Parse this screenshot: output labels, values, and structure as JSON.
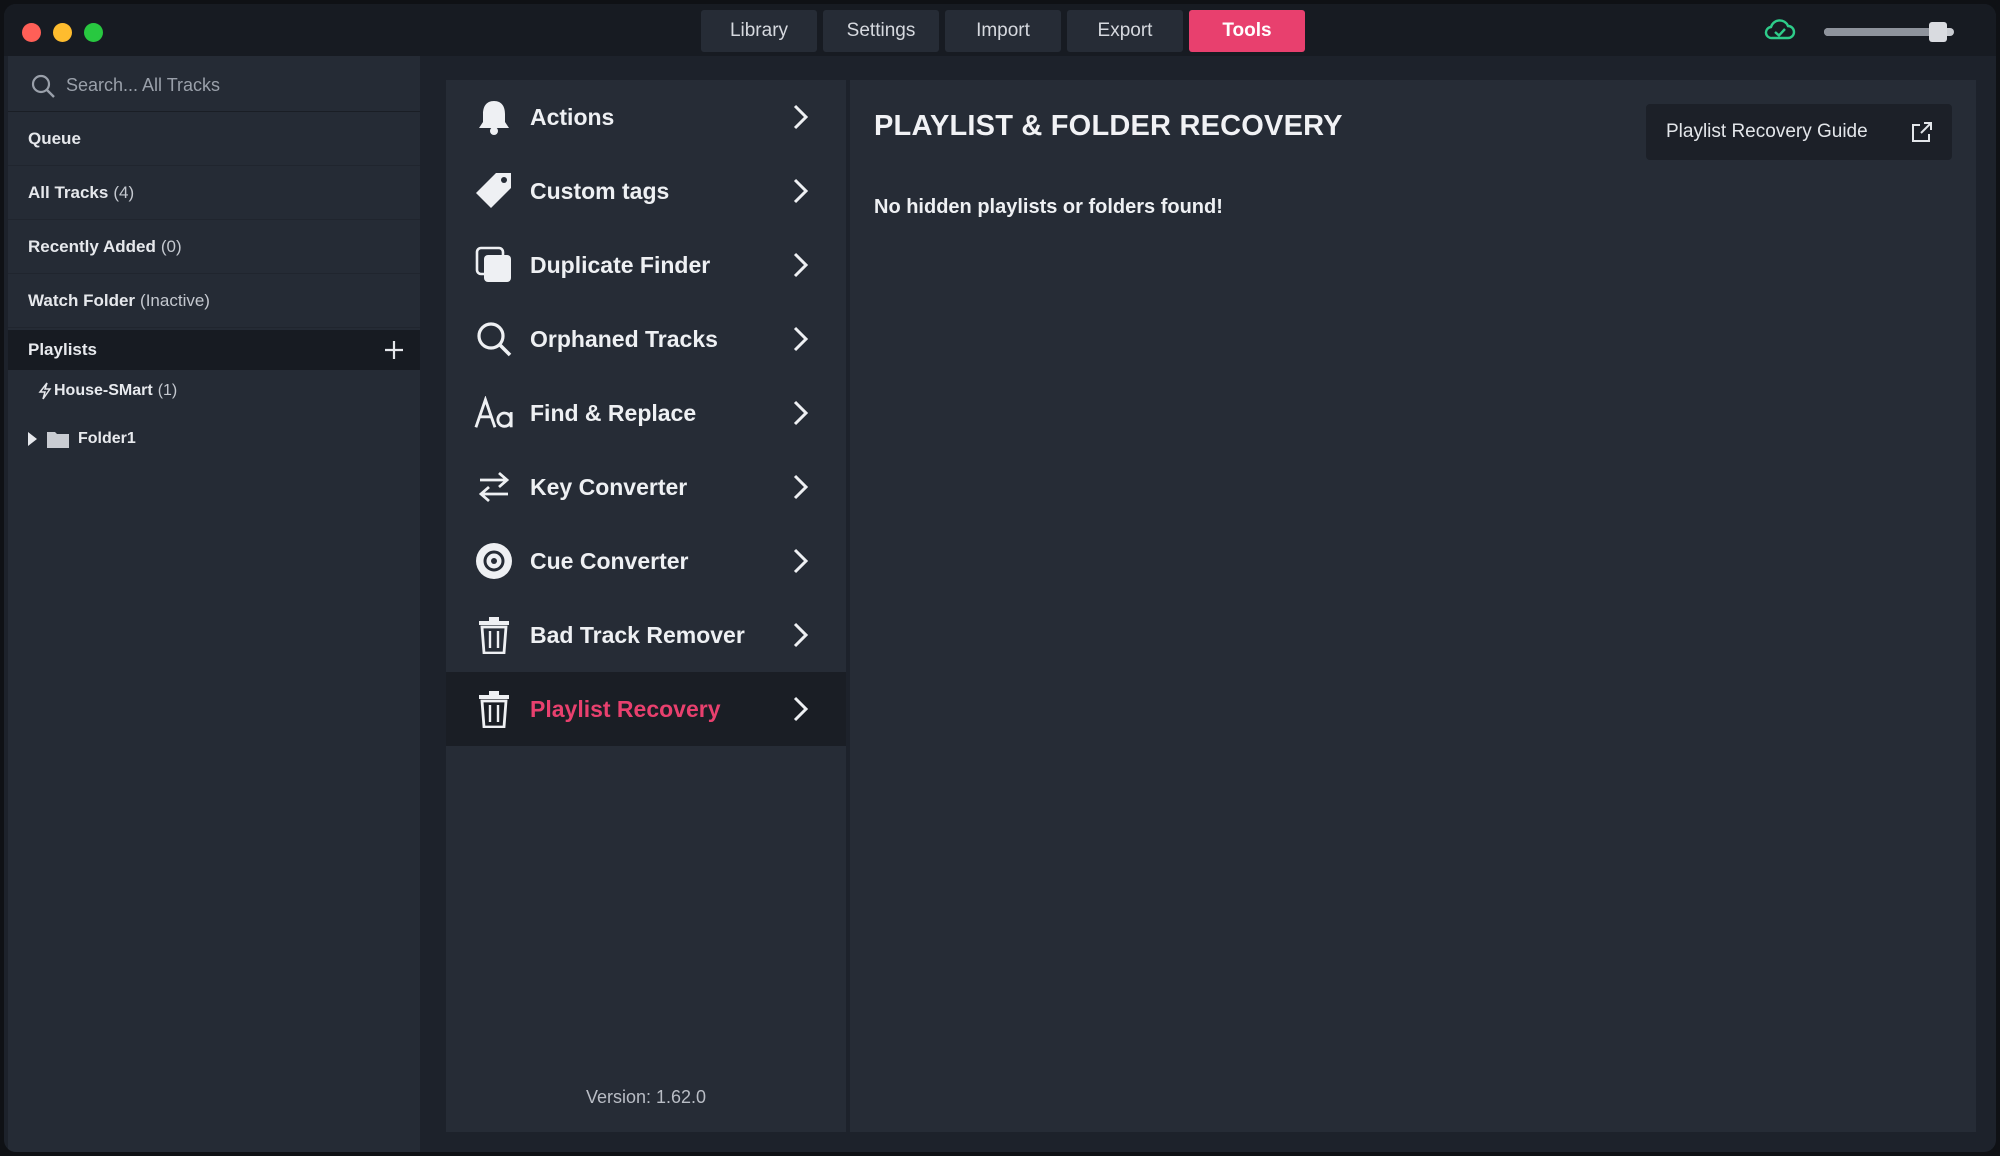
{
  "nav": {
    "tabs": [
      {
        "label": "Library"
      },
      {
        "label": "Settings"
      },
      {
        "label": "Import"
      },
      {
        "label": "Export"
      },
      {
        "label": "Tools"
      }
    ],
    "active_tab": "Tools"
  },
  "volume": {
    "level": 0.88
  },
  "sidebar": {
    "search_placeholder": "Search... All Tracks",
    "items": [
      {
        "label": "Queue",
        "count": ""
      },
      {
        "label": "All Tracks",
        "count": "(4)"
      },
      {
        "label": "Recently Added",
        "count": "(0)"
      },
      {
        "label": "Watch Folder",
        "count": "(Inactive)"
      }
    ],
    "playlists_label": "Playlists",
    "playlists": [
      {
        "label": "House-SMart",
        "count": "(1)"
      }
    ],
    "folders": [
      {
        "label": "Folder1"
      }
    ]
  },
  "tools": {
    "items": [
      {
        "label": "Actions",
        "icon": "bell-icon"
      },
      {
        "label": "Custom tags",
        "icon": "tag-icon"
      },
      {
        "label": "Duplicate Finder",
        "icon": "copy-icon"
      },
      {
        "label": "Orphaned Tracks",
        "icon": "search-icon"
      },
      {
        "label": "Find & Replace",
        "icon": "text-icon"
      },
      {
        "label": "Key Converter",
        "icon": "swap-icon"
      },
      {
        "label": "Cue Converter",
        "icon": "target-icon"
      },
      {
        "label": "Bad Track Remover",
        "icon": "trash-icon"
      },
      {
        "label": "Playlist Recovery",
        "icon": "trash-icon"
      }
    ],
    "active": "Playlist Recovery",
    "version": "Version: 1.62.0"
  },
  "content": {
    "title": "PLAYLIST & FOLDER RECOVERY",
    "message": "No hidden playlists or folders found!",
    "guide_button": "Playlist Recovery Guide"
  },
  "colors": {
    "accent": "#e8406e",
    "cloud": "#2ecc8a"
  }
}
